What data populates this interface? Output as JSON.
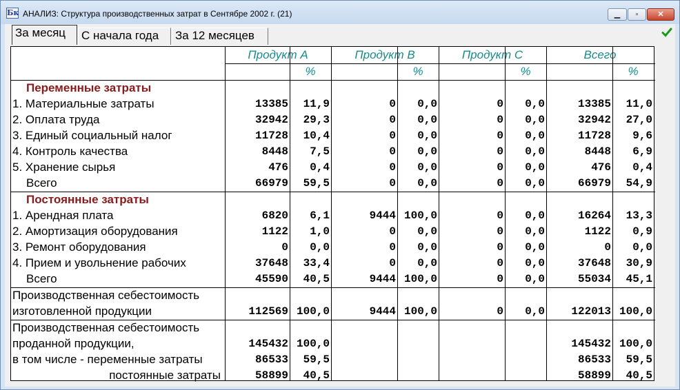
{
  "window": {
    "title": "АНАЛИЗ: Структура производственных затрат в Сентябре 2002 г. (21)",
    "icon_text": "Бк",
    "icon": "app-icon",
    "controls": {
      "minimize_icon": "minimize-icon",
      "maximize_icon": "maximize-icon",
      "close_icon": "close-icon"
    }
  },
  "tabs": [
    "За месяц",
    "С начала года",
    "За 12 месяцев"
  ],
  "active_tab": 0,
  "accent_colors": {
    "section": "#8b1a1a",
    "header": "#1a8a8a",
    "check": "#1a9a1a"
  },
  "table": {
    "columns": [
      {
        "title": "Продукт A",
        "pct": "%"
      },
      {
        "title": "Продукт B",
        "pct": "%"
      },
      {
        "title": "Продукт C",
        "pct": "%"
      },
      {
        "title": "Всего",
        "pct": "%"
      }
    ],
    "variable_header": "Переменные затраты",
    "variable_rows": [
      {
        "label": "1. Материальные затраты",
        "v": [
          "13385",
          "11,9",
          "0",
          "0,0",
          "0",
          "0,0",
          "13385",
          "11,0"
        ]
      },
      {
        "label": "2. Оплата труда",
        "v": [
          "32942",
          "29,3",
          "0",
          "0,0",
          "0",
          "0,0",
          "32942",
          "27,0"
        ]
      },
      {
        "label": "3. Единый социальный налог",
        "v": [
          "11728",
          "10,4",
          "0",
          "0,0",
          "0",
          "0,0",
          "11728",
          "9,6"
        ]
      },
      {
        "label": "4. Контроль качества",
        "v": [
          "8448",
          "7,5",
          "0",
          "0,0",
          "0",
          "0,0",
          "8448",
          "6,9"
        ]
      },
      {
        "label": "5. Хранение сырья",
        "v": [
          "476",
          "0,4",
          "0",
          "0,0",
          "0",
          "0,0",
          "476",
          "0,4"
        ]
      },
      {
        "label": "Всего",
        "v": [
          "66979",
          "59,5",
          "0",
          "0,0",
          "0",
          "0,0",
          "66979",
          "54,9"
        ]
      }
    ],
    "fixed_header": "Постоянные затраты",
    "fixed_rows": [
      {
        "label": "1. Арендная плата",
        "v": [
          "6820",
          "6,1",
          "9444",
          "100,0",
          "0",
          "0,0",
          "16264",
          "13,3"
        ]
      },
      {
        "label": "2. Амортизация оборудования",
        "v": [
          "1122",
          "1,0",
          "0",
          "0,0",
          "0",
          "0,0",
          "1122",
          "0,9"
        ]
      },
      {
        "label": "3. Ремонт оборудования",
        "v": [
          "0",
          "0,0",
          "0",
          "0,0",
          "0",
          "0,0",
          "0",
          "0,0"
        ]
      },
      {
        "label": "4. Прием и увольнение рабочих",
        "v": [
          "37648",
          "33,4",
          "0",
          "0,0",
          "0",
          "0,0",
          "37648",
          "30,9"
        ]
      },
      {
        "label": "Всего",
        "v": [
          "45590",
          "40,5",
          "9444",
          "100,0",
          "0",
          "0,0",
          "55034",
          "45,1"
        ]
      }
    ],
    "produced": {
      "label_1": "Производственная себестоимость",
      "label_2": "изготовленной продукции",
      "v": [
        "112569",
        "100,0",
        "9444",
        "100,0",
        "0",
        "0,0",
        "122013",
        "100,0"
      ]
    },
    "sold": {
      "label_1": "Производственная себестоимость",
      "rows": [
        {
          "label": "проданной продукции,",
          "v": [
            "145432",
            "100,0",
            "",
            "",
            "",
            "",
            "145432",
            "100,0"
          ]
        },
        {
          "label": "в том числе - переменные затраты",
          "v": [
            "86533",
            "59,5",
            "",
            "",
            "",
            "",
            "86533",
            "59,5"
          ]
        },
        {
          "label": "постоянные затраты",
          "v": [
            "58899",
            "40,5",
            "",
            "",
            "",
            "",
            "58899",
            "40,5"
          ]
        }
      ]
    }
  }
}
